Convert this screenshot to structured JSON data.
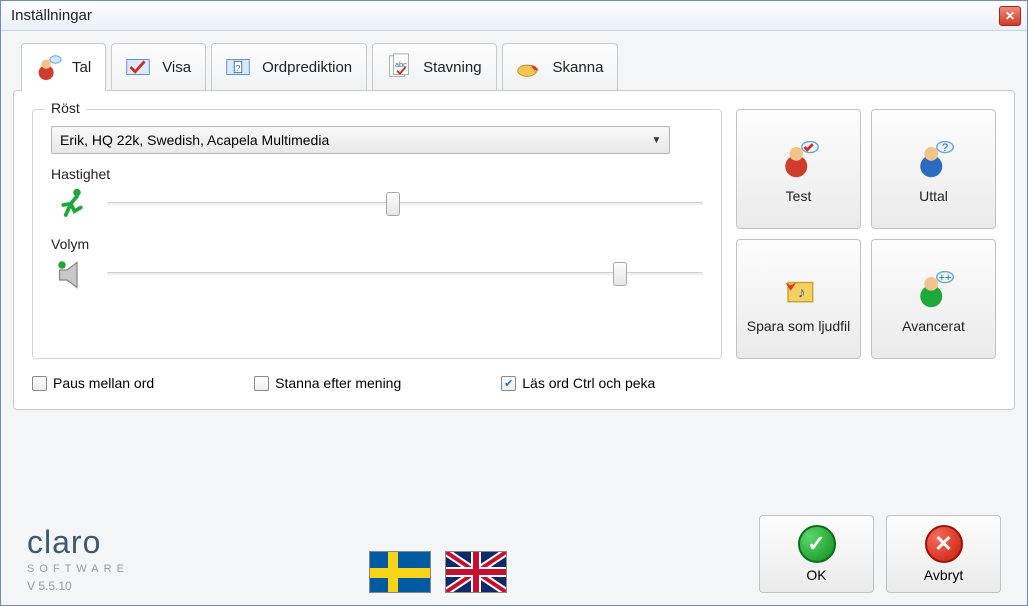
{
  "window": {
    "title": "Inställningar"
  },
  "tabs": [
    {
      "label": "Tal"
    },
    {
      "label": "Visa"
    },
    {
      "label": "Ordprediktion"
    },
    {
      "label": "Stavning"
    },
    {
      "label": "Skanna"
    }
  ],
  "voice": {
    "legend": "Röst",
    "selected": "Erik, HQ 22k, Swedish, Acapela Multimedia",
    "speed_label": "Hastighet",
    "speed_value": 48,
    "volume_label": "Volym",
    "volume_value": 86
  },
  "side": {
    "test": "Test",
    "uttal": "Uttal",
    "save_audio": "Spara som ljudfil",
    "advanced": "Avancerat"
  },
  "checks": {
    "pause_words": {
      "label": "Paus mellan ord",
      "checked": false
    },
    "stop_sentence": {
      "label": "Stanna efter mening",
      "checked": false
    },
    "read_ctrl": {
      "label": "Läs ord Ctrl och peka",
      "checked": true
    }
  },
  "brand": {
    "name": "claro",
    "sub": "SOFTWARE",
    "version": "V 5.5.10"
  },
  "footer": {
    "ok": "OK",
    "cancel": "Avbryt"
  }
}
